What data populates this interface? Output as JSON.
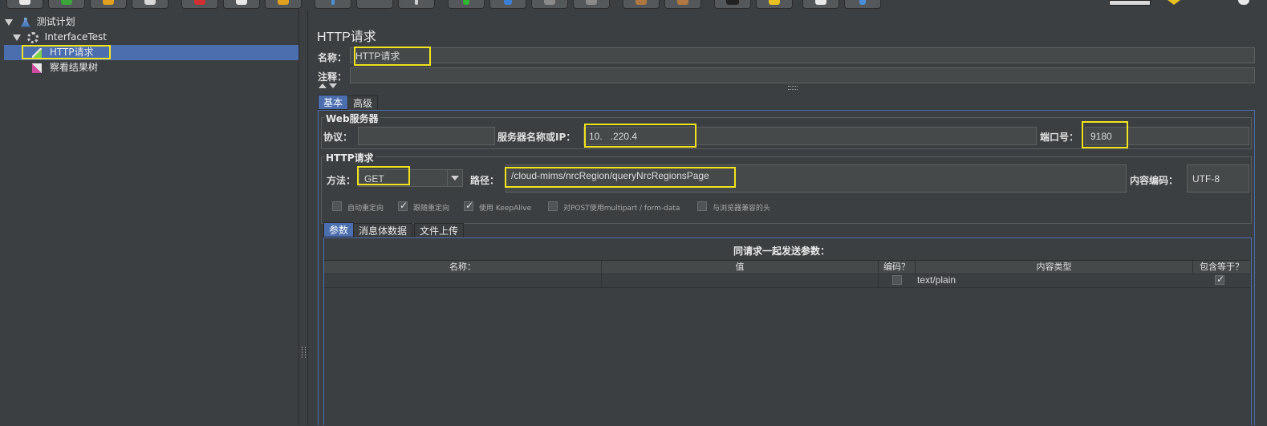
{
  "tree": {
    "items": [
      {
        "label": "测试计划"
      },
      {
        "label": "InterfaceTest"
      },
      {
        "label": "HTTP请求"
      },
      {
        "label": "察看结果树"
      }
    ]
  },
  "panel": {
    "title": "HTTP请求",
    "name_label": "名称：",
    "name_value": "HTTP请求",
    "comment_label": "注释："
  },
  "tabs": {
    "basic": "基本",
    "advanced": "高级"
  },
  "web_server": {
    "title": "Web服务器",
    "protocol_label": "协议：",
    "protocol_value": "",
    "server_label": "服务器名称或IP：",
    "server_value": "10.   .220.4",
    "port_label": "端口号：",
    "port_value": "9180"
  },
  "http_request": {
    "title": "HTTP请求",
    "method_label": "方法：",
    "method_value": "GET",
    "path_label": "路径：",
    "path_value": "/cloud-mims/nrcRegion/queryNrcRegionsPage",
    "encoding_label": "内容编码：",
    "encoding_value": "UTF-8"
  },
  "options": [
    {
      "label": "自动重定向",
      "checked": false
    },
    {
      "label": "跟随重定向",
      "checked": true
    },
    {
      "label": "使用 KeepAlive",
      "checked": true
    },
    {
      "label": "对POST使用multipart / form-data",
      "checked": false
    },
    {
      "label": "与浏览器兼容的头",
      "checked": false
    }
  ],
  "param_tabs": {
    "params": "参数",
    "body": "消息体数据",
    "files": "文件上传"
  },
  "params_table": {
    "caption": "同请求一起发送参数：",
    "headers": [
      "名称：",
      "值",
      "编码？",
      "内容类型",
      "包含等于？"
    ],
    "row": {
      "name": "",
      "value": "",
      "encode": false,
      "content_type": "text/plain",
      "include_equals": true
    }
  },
  "colors": {
    "background": "#3c3f41",
    "selection": "#4b6eaf",
    "highlight": "#f1e41d"
  }
}
